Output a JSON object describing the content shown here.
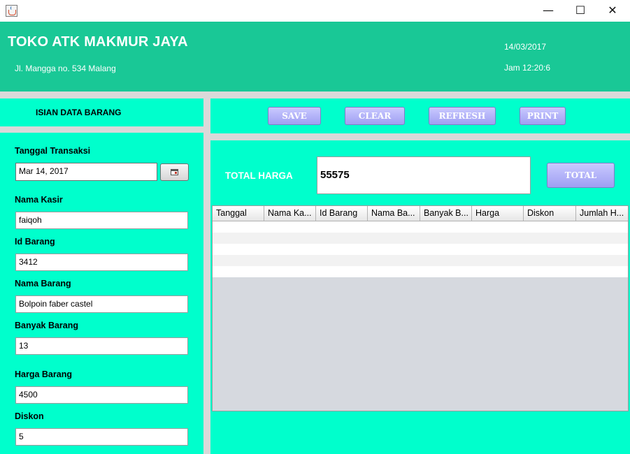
{
  "window": {
    "icon": "java-cup-icon",
    "controls": {
      "minimize": "—",
      "maximize": "☐",
      "close": "✕"
    }
  },
  "header": {
    "shop_name": "TOKO ATK MAKMUR JAYA",
    "address": "Jl. Mangga no. 534 Malang",
    "date": "14/03/2017",
    "time": "Jam 12:20:6"
  },
  "form": {
    "title": "ISIAN DATA BARANG",
    "tanggal_label": "Tanggal Transaksi",
    "tanggal_value": "Mar 14, 2017",
    "kasir_label": "Nama Kasir",
    "kasir_value": "faiqoh",
    "id_label": "Id Barang",
    "id_value": "3412",
    "nama_label": "Nama Barang",
    "nama_value": "Bolpoin faber castel",
    "banyak_label": "Banyak Barang",
    "banyak_value": "13",
    "harga_label": "Harga Barang",
    "harga_value": "4500",
    "diskon_label": "Diskon",
    "diskon_value": "5"
  },
  "toolbar": {
    "save": "SAVE",
    "clear": "CLEAR",
    "refresh": "REFRESH",
    "print": "PRINT"
  },
  "total": {
    "label": "TOTAL HARGA",
    "value": "55575",
    "button": "TOTAL"
  },
  "table": {
    "columns": [
      "Tanggal",
      "Nama Ka...",
      "Id Barang",
      "Nama Ba...",
      "Banyak B...",
      "Harga",
      "Diskon",
      "Jumlah H..."
    ],
    "rows": []
  },
  "colors": {
    "header_bg": "#19c896",
    "panel_bg": "#00ffcc",
    "button_bg": "#a9a9f5"
  }
}
